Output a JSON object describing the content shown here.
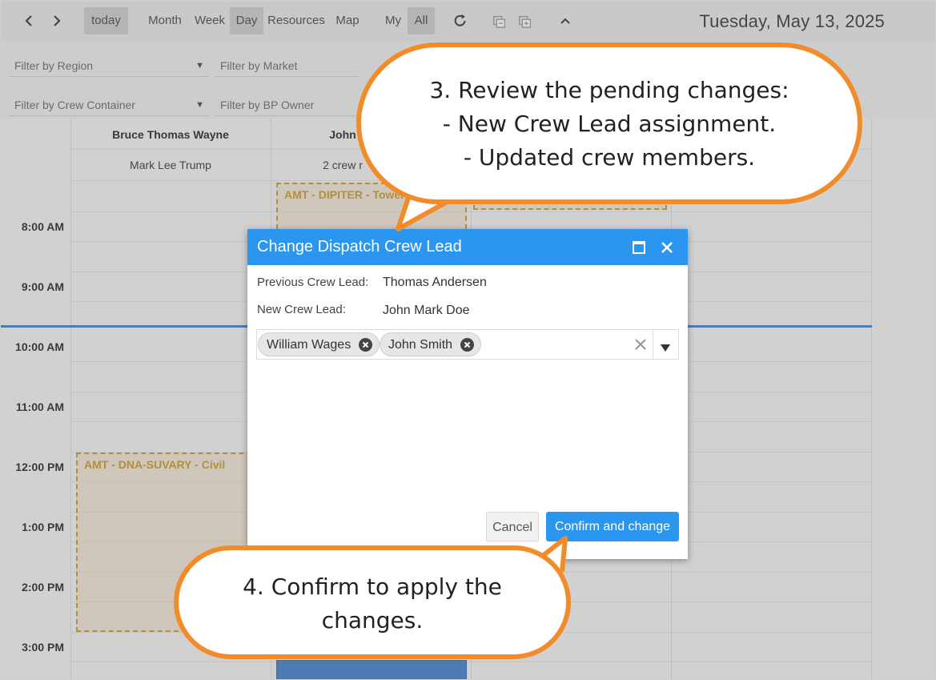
{
  "toolbar": {
    "today": "today",
    "views": [
      "Month",
      "Week",
      "Day",
      "Resources",
      "Map"
    ],
    "active_view": "Day",
    "my": "My",
    "all": "All",
    "date": "Tuesday, May 13, 2025"
  },
  "filters": {
    "region": "Filter by Region",
    "market": "Filter by Market",
    "crew_container": "Filter by Crew Container",
    "bp_owner": "Filter by BP Owner"
  },
  "calendar": {
    "resources": [
      {
        "name": "Bruce Thomas Wayne",
        "sub": "Mark Lee Trump"
      },
      {
        "name": "John",
        "sub": "2 crew r"
      }
    ],
    "times": [
      "8:00 AM",
      "9:00 AM",
      "10:00 AM",
      "11:00 AM",
      "12:00 PM",
      "1:00 PM",
      "2:00 PM",
      "3:00 PM"
    ],
    "events": [
      {
        "label": "AMT - DIPITER - Tower"
      },
      {
        "label": "AMT - DNA-SUVARY - Civil"
      }
    ]
  },
  "dialog": {
    "title": "Change Dispatch Crew Lead",
    "previous_label": "Previous Crew Lead:",
    "previous_value": "Thomas Andersen",
    "new_label": "New Crew Lead:",
    "new_value": "John Mark Doe",
    "members": [
      "William Wages",
      "John Smith"
    ],
    "cancel": "Cancel",
    "confirm": "Confirm and change"
  },
  "callouts": {
    "review": [
      "3. Review the pending changes:",
      "- New Crew Lead assignment.",
      "- Updated crew members."
    ],
    "confirm": [
      "4. Confirm to apply the",
      "changes."
    ]
  },
  "colors": {
    "accent": "#2b96ef",
    "callout_border": "#f28b2a",
    "event_border": "#c79a26",
    "now_line": "#3d7ec9"
  }
}
